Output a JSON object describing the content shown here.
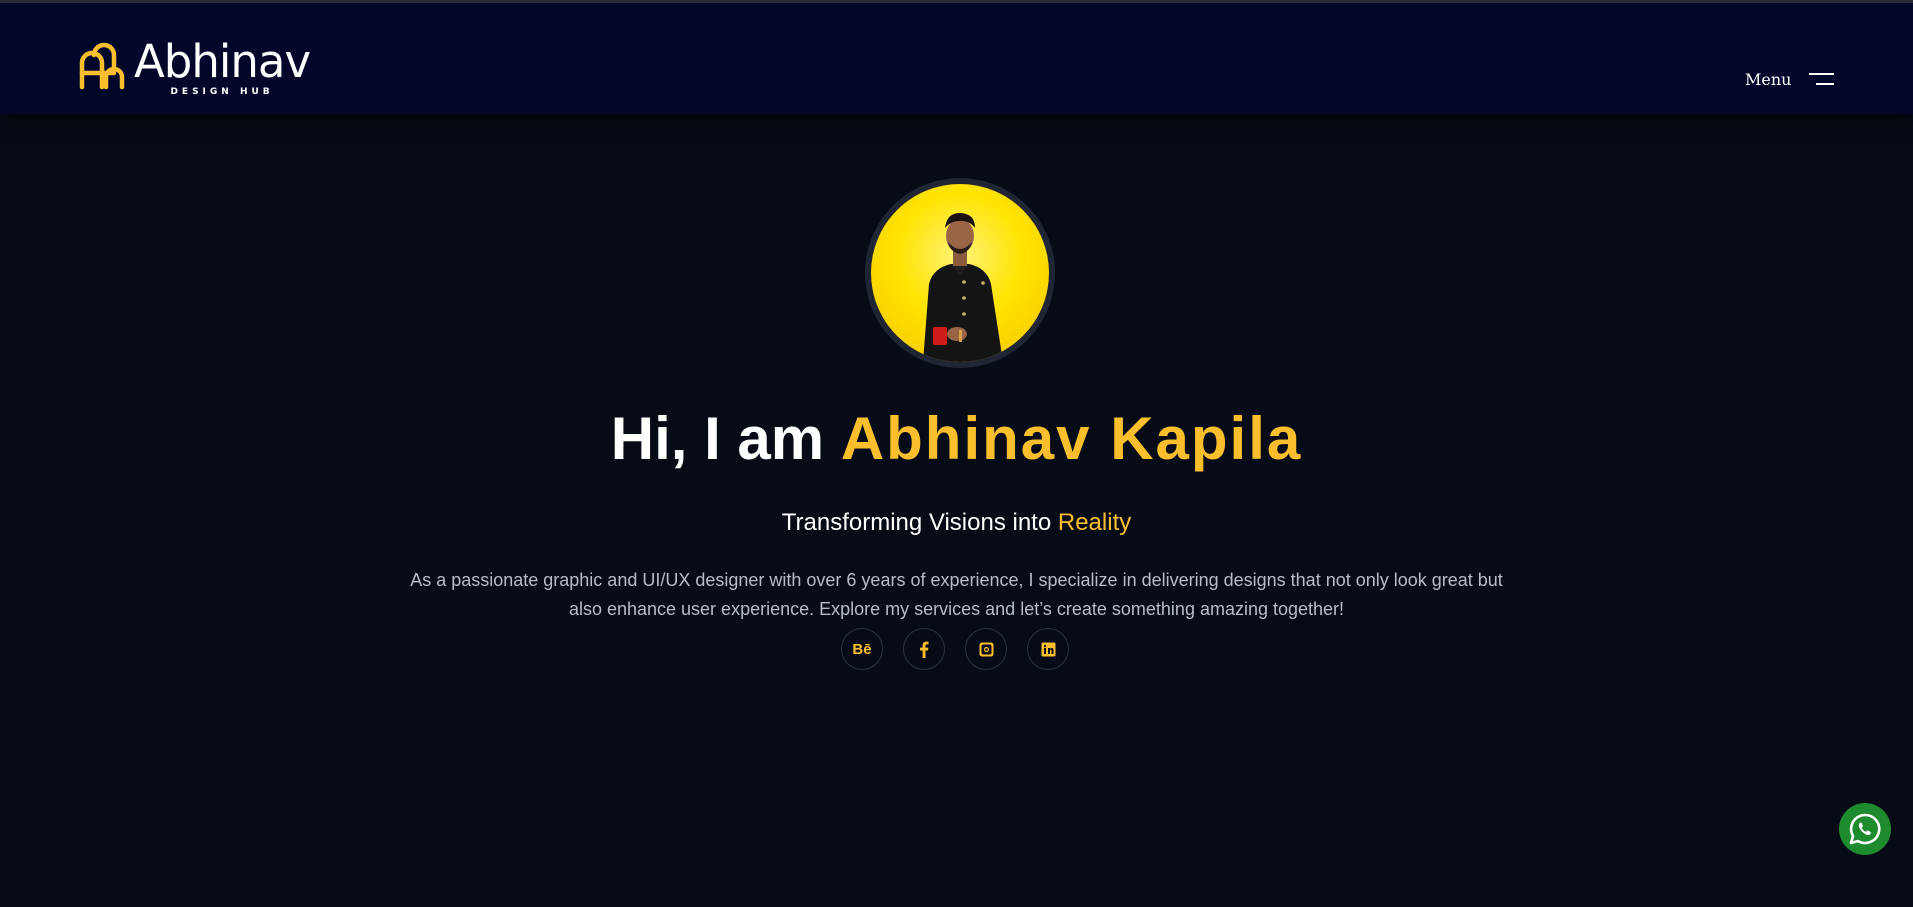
{
  "header": {
    "logo": {
      "word": "Abhinav",
      "sub": "DESIGN HUB"
    },
    "menu_label": "Menu"
  },
  "hero": {
    "title_prefix": "Hi, I am ",
    "title_name": "Abhinav Kapila",
    "subtitle_prefix": "Transforming Visions into ",
    "subtitle_accent": "Reality",
    "description": "As a passionate graphic and UI/UX designer with over 6 years of experience, I specialize in delivering designs that not only look great but also enhance user experience. Explore my services and let’s create something amazing together!"
  },
  "socials": [
    {
      "name": "behance",
      "label": "Bē"
    },
    {
      "name": "facebook",
      "label": "f"
    },
    {
      "name": "instagram",
      "label": ""
    },
    {
      "name": "linkedin",
      "label": ""
    }
  ],
  "colors": {
    "accent": "#fbbf2e",
    "header_bg": "#02072a",
    "page_bg": "#070b16",
    "whatsapp": "#1f8b2f"
  },
  "icons": {
    "logo": "abhinav-logo-icon",
    "menu": "hamburger-icon",
    "behance": "behance-icon",
    "facebook": "facebook-icon",
    "instagram": "instagram-icon",
    "linkedin": "linkedin-icon",
    "whatsapp": "whatsapp-icon"
  }
}
